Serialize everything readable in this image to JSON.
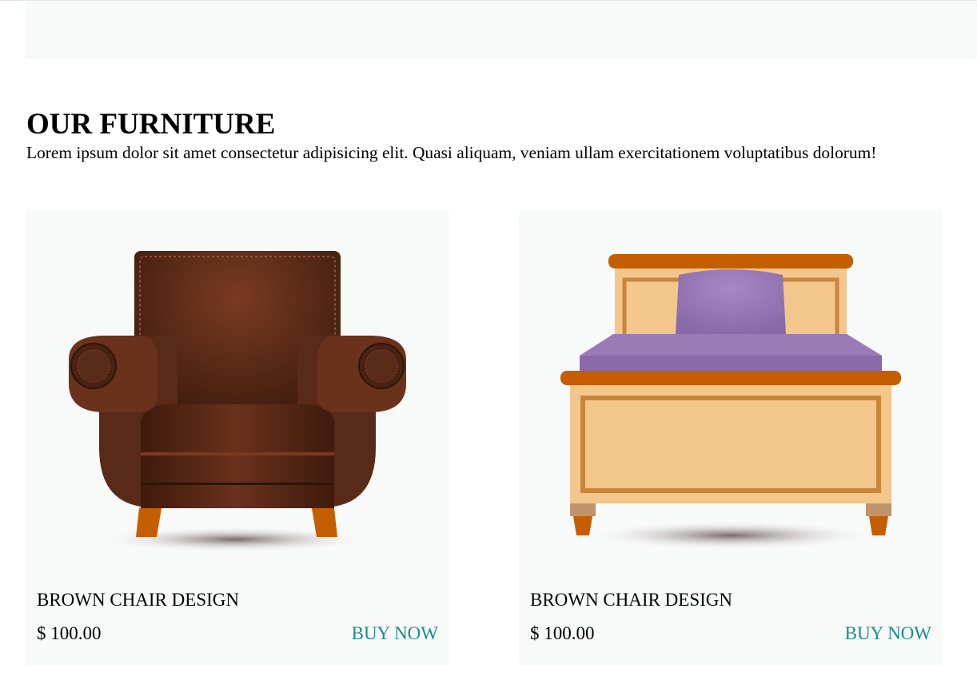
{
  "section": {
    "title": "OUR FURNITURE",
    "description": "Lorem ipsum dolor sit amet consectetur adipisicing elit. Quasi aliquam, veniam ullam exercitationem voluptatibus dolorum!"
  },
  "products": [
    {
      "name": "BROWN CHAIR DESIGN",
      "price": "$ 100.00",
      "cta": "BUY NOW",
      "image": "brown-armchair"
    },
    {
      "name": "BROWN CHAIR DESIGN",
      "price": "$ 100.00",
      "cta": "BUY NOW",
      "image": "bed"
    }
  ],
  "colors": {
    "accent": "#1a8c8c",
    "card_bg": "#f8f9f9",
    "chair_leather": "#5a2a18",
    "chair_legs": "#c45e00",
    "bed_wood": "#f3c68c",
    "bed_trim": "#c86400",
    "bed_sheet": "#9b7ab8"
  }
}
